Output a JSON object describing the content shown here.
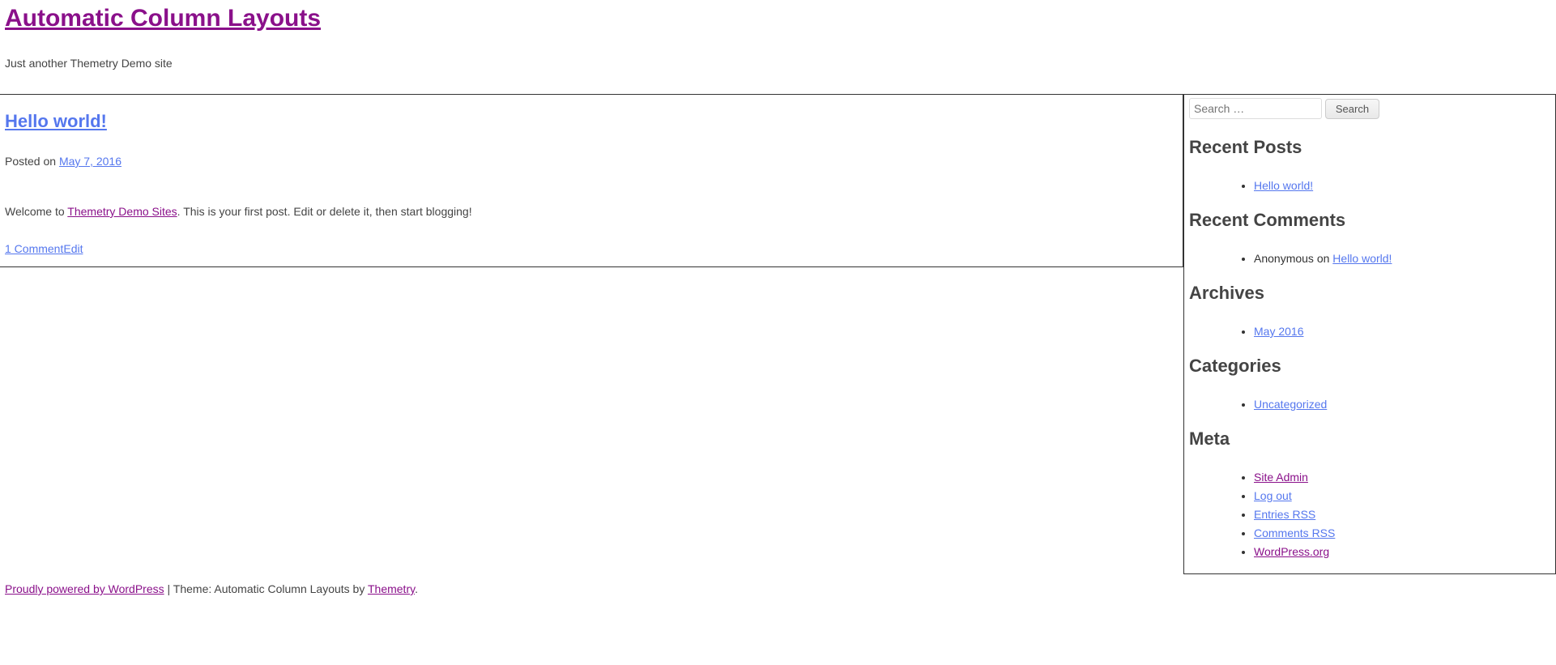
{
  "header": {
    "site_title": "Automatic Column Layouts",
    "tagline": "Just another Themetry Demo site"
  },
  "post": {
    "title": "Hello world!",
    "posted_on_label": "Posted on ",
    "date": "May 7, 2016",
    "content_prefix": "Welcome to ",
    "content_link": "Themetry Demo Sites",
    "content_suffix": ". This is your first post. Edit or delete it, then start blogging!",
    "comment_link": "1 Comment",
    "edit_link": "Edit"
  },
  "sidebar": {
    "search_placeholder": "Search …",
    "search_button": "Search",
    "recent_posts": {
      "heading": "Recent Posts",
      "items": [
        "Hello world!"
      ]
    },
    "recent_comments": {
      "heading": "Recent Comments",
      "author": "Anonymous",
      "on_label": " on ",
      "target": "Hello world!"
    },
    "archives": {
      "heading": "Archives",
      "items": [
        "May 2016"
      ]
    },
    "categories": {
      "heading": "Categories",
      "items": [
        "Uncategorized"
      ]
    },
    "meta": {
      "heading": "Meta",
      "items": [
        {
          "label": "Site Admin",
          "visited": true
        },
        {
          "label": "Log out",
          "visited": false
        },
        {
          "label": "Entries RSS",
          "visited": false
        },
        {
          "label": "Comments RSS",
          "visited": false
        },
        {
          "label": "WordPress.org",
          "visited": true
        }
      ]
    }
  },
  "footer": {
    "powered": "Proudly powered by WordPress",
    "sep": " | ",
    "theme_prefix": "Theme: Automatic Column Layouts by ",
    "theme_link": "Themetry",
    "period": "."
  }
}
